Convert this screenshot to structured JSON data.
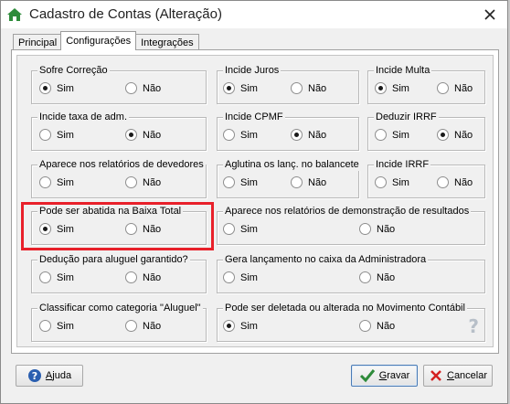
{
  "window": {
    "title": "Cadastro de Contas (Alteração)",
    "title_icon": "home-icon",
    "close_icon": "close-icon",
    "accent_color": "#2e8b3a"
  },
  "tabs": [
    {
      "label": "Principal",
      "active": false
    },
    {
      "label": "Configurações",
      "active": true
    },
    {
      "label": "Integrações",
      "active": false
    }
  ],
  "option_labels": {
    "yes": "Sim",
    "no": "Não"
  },
  "groups": {
    "sofre_correcao": {
      "title": "Sofre Correção",
      "selected": "Sim"
    },
    "incide_juros": {
      "title": "Incide Juros",
      "selected": "Sim"
    },
    "incide_multa": {
      "title": "Incide Multa",
      "selected": "Sim"
    },
    "incide_taxa_adm": {
      "title": "Incide taxa de adm.",
      "selected": "Não"
    },
    "incide_cpmf": {
      "title": "Incide CPMF",
      "selected": "Não"
    },
    "deduzir_irrf": {
      "title": "Deduzir IRRF",
      "selected": "Não"
    },
    "aparece_relatorios_devedores": {
      "title": "Aparece nos relatórios de devedores",
      "selected": null
    },
    "aglutina_lanc": {
      "title": "Aglutina os lanç. no balancete",
      "selected": null
    },
    "incide_irrf": {
      "title": "Incide IRRF",
      "selected": null
    },
    "pode_ser_abatida": {
      "title": "Pode ser abatida na Baixa Total",
      "selected": "Sim"
    },
    "aparece_relatorios_demonstracao": {
      "title": "Aparece nos relatórios de demonstração de resultados",
      "selected": null
    },
    "deducao_aluguel": {
      "title": "Dedução para aluguel garantido?",
      "selected": null
    },
    "gera_lancamento": {
      "title": "Gera lançamento no caixa da Administradora",
      "selected": null
    },
    "classificar_categoria": {
      "title": "Classificar como categoria \"Aluguel\"",
      "selected": null
    },
    "pode_ser_deletada": {
      "title": "Pode ser deletada ou alterada no Movimento Contábil",
      "selected": "Sim"
    }
  },
  "highlight_color": "#e8202a",
  "help_glyph": "?",
  "buttons": {
    "ajuda": {
      "prefix": "",
      "mnemonic": "A",
      "rest": "juda",
      "icon": "help-icon"
    },
    "gravar": {
      "prefix": "",
      "mnemonic": "G",
      "rest": "ravar",
      "icon": "checkmark-icon"
    },
    "cancelar": {
      "prefix": "",
      "mnemonic": "C",
      "rest": "ancelar",
      "icon": "x-icon"
    }
  }
}
